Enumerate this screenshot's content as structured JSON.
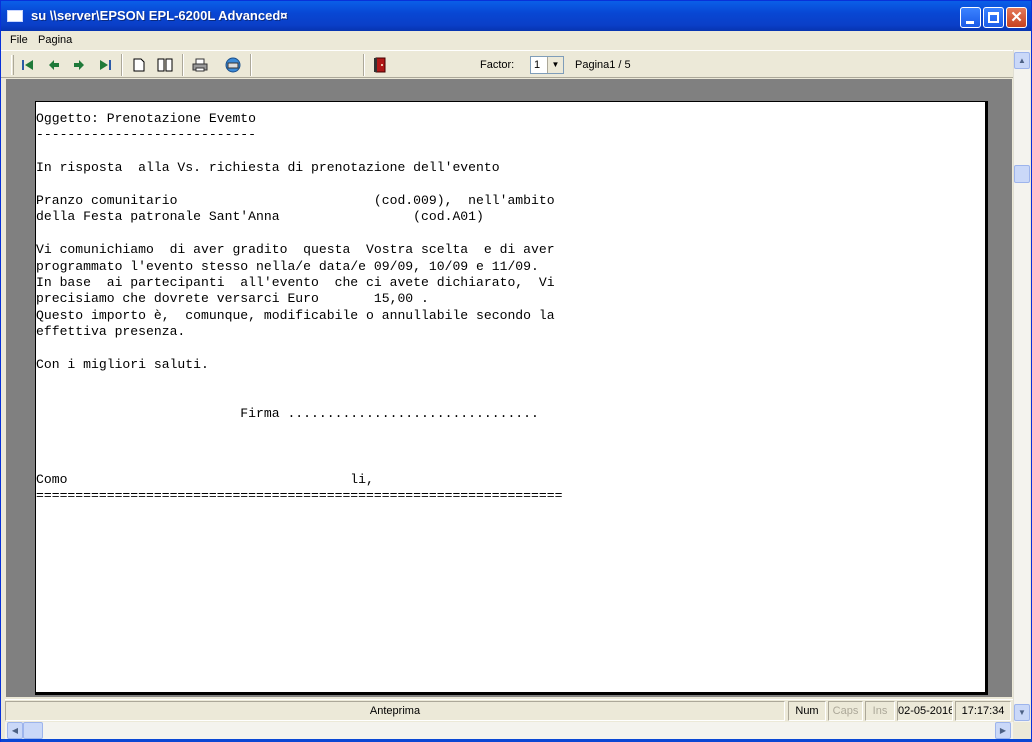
{
  "window": {
    "title": "su \\\\server\\EPSON EPL-6200L Advanced¤",
    "controls": {
      "minimize": "minimize",
      "maximize": "restore",
      "close": "✕"
    }
  },
  "menu": {
    "items": [
      {
        "label": "File"
      },
      {
        "label": "Pagina"
      }
    ]
  },
  "toolbar": {
    "first_icon": "first-page-icon",
    "prev_icon": "previous-page-icon",
    "next_icon": "next-page-icon",
    "last_icon": "last-page-icon",
    "single_page_icon": "single-page-icon",
    "two_pages_icon": "two-pages-icon",
    "print_icon": "printer-icon",
    "setup_icon": "print-setup-icon",
    "exit_icon": "exit-door-icon",
    "factor_label": "Factor:",
    "factor_value": "1",
    "page_info": "Pagina1 / 5"
  },
  "document": {
    "text": "Oggetto: Prenotazione Evemto\n----------------------------\n\nIn risposta  alla Vs. richiesta di prenotazione dell'evento\n\nPranzo comunitario                         (cod.009),  nell'ambito\ndella Festa patronale Sant'Anna                 (cod.A01)\n\nVi comunichiamo  di aver gradito  questa  Vostra scelta  e di aver\nprogrammato l'evento stesso nella/e data/e 09/09, 10/09 e 11/09.\nIn base  ai partecipanti  all'evento  che ci avete dichiarato,  Vi\nprecisiamo che dovrete versarci Euro       15,00 .\nQuesto importo è,  comunque, modificabile o annullabile secondo la\neffettiva presenza.\n\nCon i migliori saluti.\n\n\n                          Firma ................................\n\n\n\nComo                                    li,\n==================================================================="
  },
  "statusbar": {
    "main": "Anteprima",
    "num": "Num",
    "caps": "Caps",
    "ins": "Ins",
    "date": "02-05-2016",
    "time": "17:17:34"
  },
  "colors": {
    "titlebar": "#0a47d4",
    "window_bg": "#ece9d8",
    "doc_bg": "#808080",
    "paper": "#ffffff"
  }
}
